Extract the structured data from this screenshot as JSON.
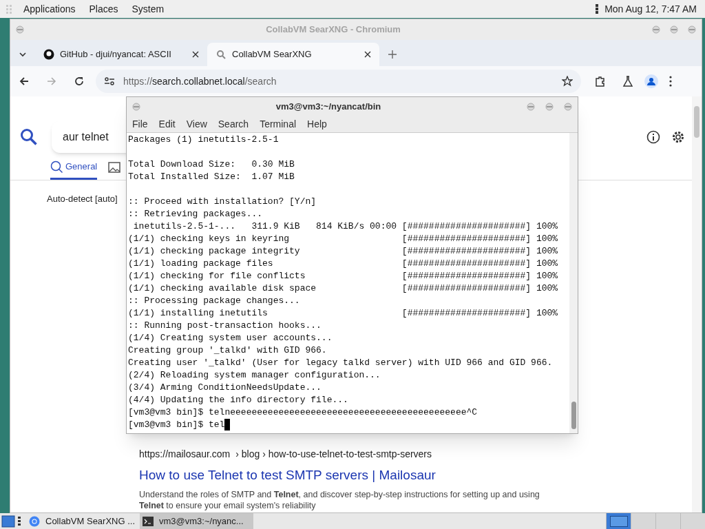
{
  "top_panel": {
    "menus": [
      "Applications",
      "Places",
      "System"
    ],
    "clock": "Mon Aug 12, 7:47 AM"
  },
  "browser": {
    "title": "CollabVM SearXNG - Chromium",
    "tabs": [
      {
        "label": "GitHub - djui/nyancat: ASCII",
        "selected": false,
        "kind": "github"
      },
      {
        "label": "CollabVM SearXNG",
        "selected": true,
        "kind": "searxng"
      }
    ],
    "address": {
      "scheme": "https://",
      "host": "search.collabnet.local",
      "path": "/search"
    },
    "page": {
      "query": "aur telnet",
      "categories": [
        {
          "label": "General",
          "selected": true,
          "kind": "search"
        },
        {
          "selected": false,
          "kind": "image"
        }
      ],
      "language": "Auto-detect [auto]",
      "result": {
        "url": "https://mailosaur.com",
        "breadcrumb": "› blog › how-to-use-telnet-to-test-smtp-servers",
        "title": "How to use Telnet to test SMTP servers | Mailosaur",
        "snippet": [
          "Understand the roles of SMTP and **Telnet**, and discover step-by-step instructions for setting up and using",
          "**Telnet** to ensure your email system's reliability"
        ]
      }
    }
  },
  "terminal": {
    "title": "vm3@vm3:~/nyancat/bin",
    "menus": [
      "File",
      "Edit",
      "View",
      "Search",
      "Terminal",
      "Help"
    ],
    "blocks": [
      [
        "Packages (1) inetutils-2.5-1"
      ],
      [
        "Total Download Size:   0.30 MiB",
        "Total Installed Size:  1.07 MiB"
      ],
      [
        ":: Proceed with installation? [Y/n]",
        ":: Retrieving packages...",
        " inetutils-2.5-1-...   311.9 KiB   814 KiB/s 00:00 [######################] 100%",
        "(1/1) checking keys in keyring                     [######################] 100%",
        "(1/1) checking package integrity                   [######################] 100%",
        "(1/1) loading package files                        [######################] 100%",
        "(1/1) checking for file conflicts                  [######################] 100%",
        "(1/1) checking available disk space                [######################] 100%",
        ":: Processing package changes...",
        "(1/1) installing inetutils                         [######################] 100%",
        ":: Running post-transaction hooks...",
        "(1/4) Creating system user accounts...",
        "Creating group '_talkd' with GID 966.",
        "Creating user '_talkd' (User for legacy talkd server) with UID 966 and GID 966.",
        "(2/4) Reloading system manager configuration...",
        "(3/4) Arming ConditionNeedsUpdate...",
        "(4/4) Updating the info directory file...",
        "[vm3@vm3 bin]$ telneeeeeeeeeeeeeeeeeeeeeeeeeeeeeeeeeeeeeeeeeeee^C",
        "[vm3@vm3 bin]$ tel"
      ]
    ]
  },
  "taskbar": {
    "items": [
      {
        "label": "CollabVM SearXNG ...",
        "selected": false,
        "kind": "browser"
      },
      {
        "label": "vm3@vm3:~/nyanc...",
        "selected": true,
        "kind": "terminal"
      }
    ],
    "workspaces": [
      {
        "selected": true
      },
      {
        "selected": false
      },
      {
        "selected": false
      },
      {
        "selected": false
      }
    ]
  }
}
